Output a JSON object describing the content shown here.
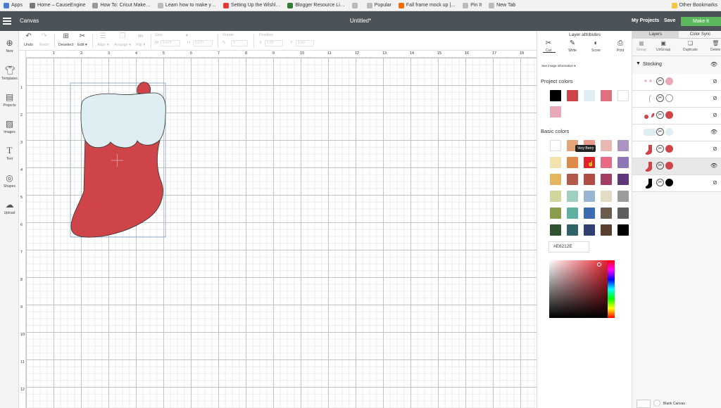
{
  "bookmarks": {
    "items": [
      {
        "label": "Apps",
        "color": "#4a7bd6"
      },
      {
        "label": "Home – CauseEngine",
        "color": "#777"
      },
      {
        "label": "How To: Cricut Make…",
        "color": "#999"
      },
      {
        "label": "Learn how to make y…",
        "color": "#bbb"
      },
      {
        "label": "Setting Up the Wishl…",
        "color": "#e53935"
      },
      {
        "label": "Blogger Resource Li…",
        "color": "#2e7d32"
      },
      {
        "label": "",
        "color": "#bbb"
      },
      {
        "label": "Popular",
        "color": "#bbb"
      },
      {
        "label": "Fall frame mock up |…",
        "color": "#ef6c00"
      },
      {
        "label": "Pin It",
        "color": "#bbb"
      },
      {
        "label": "New Tab",
        "color": "#bbb"
      }
    ],
    "other": "Other Bookmarks"
  },
  "header": {
    "app_title": "Canvas",
    "doc_title": "Untitled*",
    "my_projects": "My Projects",
    "save": "Save",
    "make_it": "Make It"
  },
  "toolbar": {
    "undo": "Undo",
    "redo": "Redo",
    "deselect": "Deselect",
    "edit": "Edit ▾",
    "align": "Align ▾",
    "arrange": "Arrange ▾",
    "flip": "Flip ▾",
    "size_label": "Size",
    "rotate_label": "Rotate",
    "position_label": "Position",
    "w_label": "W",
    "w_value": "3.475",
    "h_label": "H",
    "h_value": "5.677",
    "rotate_value": "0",
    "x_label": "X",
    "x_value": "1.00",
    "y_label": "Y",
    "y_value": "1.00"
  },
  "sidebar": {
    "items": [
      {
        "label": "New",
        "icon": "plus-icon"
      },
      {
        "label": "Templates",
        "icon": "shirt-icon"
      },
      {
        "label": "Projects",
        "icon": "projects-icon"
      },
      {
        "label": "Images",
        "icon": "images-icon"
      },
      {
        "label": "Text",
        "icon": "text-icon"
      },
      {
        "label": "Shapes",
        "icon": "shapes-icon"
      },
      {
        "label": "Upload",
        "icon": "upload-icon"
      }
    ]
  },
  "rulers": {
    "top": [
      "1",
      "2",
      "3",
      "4",
      "5",
      "6",
      "7",
      "8",
      "9",
      "10",
      "11",
      "12",
      "13",
      "14",
      "15",
      "16",
      "17",
      "18"
    ],
    "left": [
      "1",
      "2",
      "3",
      "4",
      "5",
      "6",
      "7",
      "8",
      "9",
      "10",
      "11",
      "12"
    ]
  },
  "layer_attributes": {
    "title": "Layer attributes",
    "tools": [
      "Cut",
      "Write",
      "Score",
      "Print"
    ],
    "image_info": "See image information ▾",
    "project_colors_title": "Project colors",
    "project_colors": [
      "#000000",
      "#cf4448",
      "#dfeef2",
      "#e06f82",
      "#ffffff",
      "#e8a8b8"
    ],
    "basic_colors_title": "Basic colors",
    "basic_colors": [
      "#ffffff",
      "#e5a57b",
      "#e9998a",
      "#e9b8b2",
      "#ab93c6",
      "#f1e3ad",
      "#df8a48",
      "#e6212e",
      "#e66a84",
      "#8d76b4",
      "#e6b45d",
      "#b45a48",
      "#b04c42",
      "#a53e64",
      "#5e367a",
      "#d1d59c",
      "#9dd0bf",
      "#97b6d6",
      "#e1dcc2",
      "#9c9c9c",
      "#899d4d",
      "#5db0a2",
      "#3b6bb0",
      "#6b5c4d",
      "#5f5f5f",
      "#2f5432",
      "#306469",
      "#313f73",
      "#5a3f2f",
      "#000000"
    ],
    "tooltip": "Very Berry",
    "hex_value": "#E6212E"
  },
  "layers_panel": {
    "tabs": [
      "Layers",
      "Color Sync"
    ],
    "tools": [
      "Group",
      "UnGroup",
      "Duplicate",
      "Delete"
    ],
    "group_name": "Stocking",
    "rows": [
      {
        "thumb": "dots",
        "color": "#e8a8b8"
      },
      {
        "thumb": "line",
        "color": "#ffffff"
      },
      {
        "thumb": "pink-shapes",
        "color": "#cf4448"
      },
      {
        "thumb": "cuff",
        "color": "#dfeef2"
      },
      {
        "thumb": "stocking",
        "color": "#cf4448"
      },
      {
        "thumb": "stocking",
        "color": "#cf4448"
      },
      {
        "thumb": "stocking",
        "color": "#000000"
      }
    ],
    "blank_canvas": "Blank Canvas"
  }
}
